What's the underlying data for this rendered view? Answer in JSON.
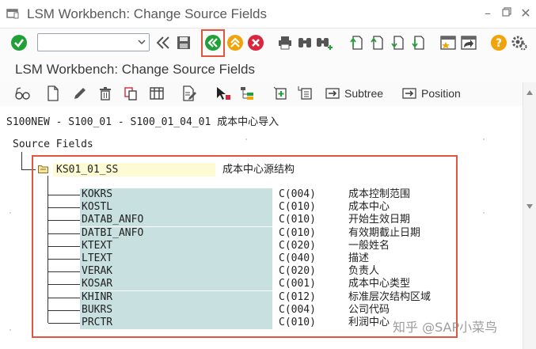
{
  "window": {
    "title": "LSM Workbench: Change Source Fields",
    "controls": [
      "minimize",
      "restore",
      "close"
    ]
  },
  "toolbar": {
    "command_field_value": "",
    "icons": [
      "enter-icon",
      "command-dropdown-icon",
      "back-double-icon",
      "save-icon",
      "back-icon",
      "exit-icon",
      "cancel-icon",
      "print-icon",
      "find-icon",
      "find-next-icon",
      "first-page-icon",
      "previous-page-icon",
      "next-page-icon",
      "last-page-icon",
      "new-session-icon",
      "shortcut-icon",
      "help-icon",
      "settings-icon"
    ],
    "highlighted_icon": "back-icon",
    "highlight_color": "#e2553f"
  },
  "app": {
    "title": "LSM Workbench: Change Source Fields",
    "actions": {
      "subtree": "Subtree",
      "position": "Position"
    }
  },
  "content": {
    "path": "S100NEW - S100_01 - S100_01_04_01 成本中心导入",
    "source_fields_label": "Source Fields",
    "structure": {
      "name": "KS01_01_SS",
      "description": "成本中心源结构"
    },
    "fields": [
      {
        "name": "KOKRS",
        "type": "C(004)",
        "desc": "成本控制范围"
      },
      {
        "name": "KOSTL",
        "type": "C(010)",
        "desc": "成本中心"
      },
      {
        "name": "DATAB_ANFO",
        "type": "C(010)",
        "desc": "开始生效日期"
      },
      {
        "name": "DATBI_ANFO",
        "type": "C(010)",
        "desc": "有效期截止日期"
      },
      {
        "name": "KTEXT",
        "type": "C(020)",
        "desc": "一般姓名"
      },
      {
        "name": "LTEXT",
        "type": "C(040)",
        "desc": "描述"
      },
      {
        "name": "VERAK",
        "type": "C(020)",
        "desc": "负责人"
      },
      {
        "name": "KOSAR",
        "type": "C(001)",
        "desc": "成本中心类型"
      },
      {
        "name": "KHINR",
        "type": "C(012)",
        "desc": "标准层次结构区域"
      },
      {
        "name": "BUKRS",
        "type": "C(004)",
        "desc": "公司代码"
      },
      {
        "name": "PRCTR",
        "type": "C(010)",
        "desc": "利润中心"
      }
    ]
  },
  "watermark": "知乎 @SAP小菜鸟"
}
